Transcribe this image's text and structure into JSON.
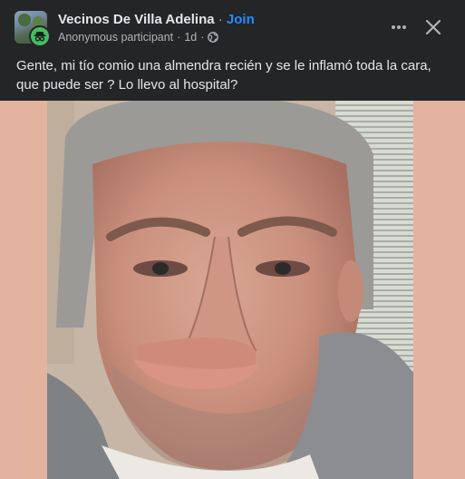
{
  "post": {
    "group_name": "Vecinos De Villa Adelina",
    "separator": "·",
    "join_label": "Join",
    "author": "Anonymous participant",
    "meta_separator": "·",
    "time": "1d",
    "privacy_icon": "globe-icon",
    "more_icon": "more-options-icon",
    "close_icon": "close-icon",
    "text": "Gente, mi tío comio una almendra recién y se le inflamó toda la cara, que puede ser ? Lo llevo al hospital?"
  },
  "colors": {
    "background": "#242526",
    "primary_text": "#e4e6eb",
    "secondary_text": "#b0b3b8",
    "link": "#2d88ff",
    "anon_badge": "#45bd62",
    "photo_matte": "#e3b3a0"
  }
}
